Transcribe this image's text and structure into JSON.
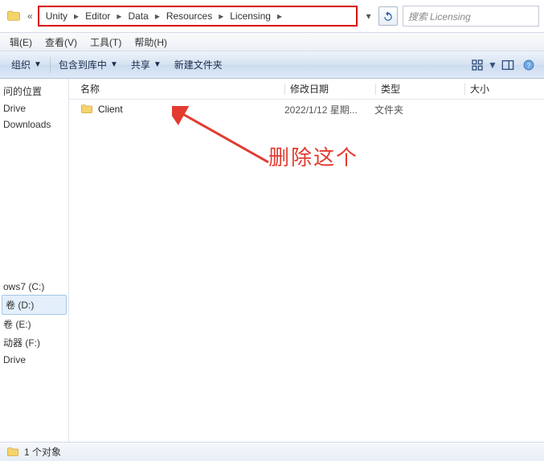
{
  "breadcrumb": {
    "double_chevron": "«",
    "items": [
      "Unity",
      "Editor",
      "Data",
      "Resources",
      "Licensing"
    ],
    "arrow": "▸"
  },
  "address": {
    "dropdown": "▾",
    "refresh": "↻"
  },
  "search": {
    "placeholder": "搜索 Licensing"
  },
  "menu": {
    "items": [
      "辑(E)",
      "查看(V)",
      "工具(T)",
      "帮助(H)"
    ]
  },
  "toolbar": {
    "organize": "组织",
    "include": "包含到库中",
    "share": "共享",
    "new_folder": "新建文件夹",
    "caret": "▼"
  },
  "columns": {
    "name": "名称",
    "date": "修改日期",
    "type": "类型",
    "size": "大小"
  },
  "files": [
    {
      "name": "Client",
      "date": "2022/1/12 星期...",
      "type": "文件夹"
    }
  ],
  "annotation": {
    "text": "删除这个"
  },
  "sidebar": {
    "group1": [
      "问的位置",
      "Drive",
      "Downloads"
    ],
    "group2": [
      "ows7 (C:)",
      "卷 (D:)",
      "卷 (E:)",
      "动器 (F:)",
      "Drive"
    ]
  },
  "status": {
    "text": "1 个对象"
  }
}
